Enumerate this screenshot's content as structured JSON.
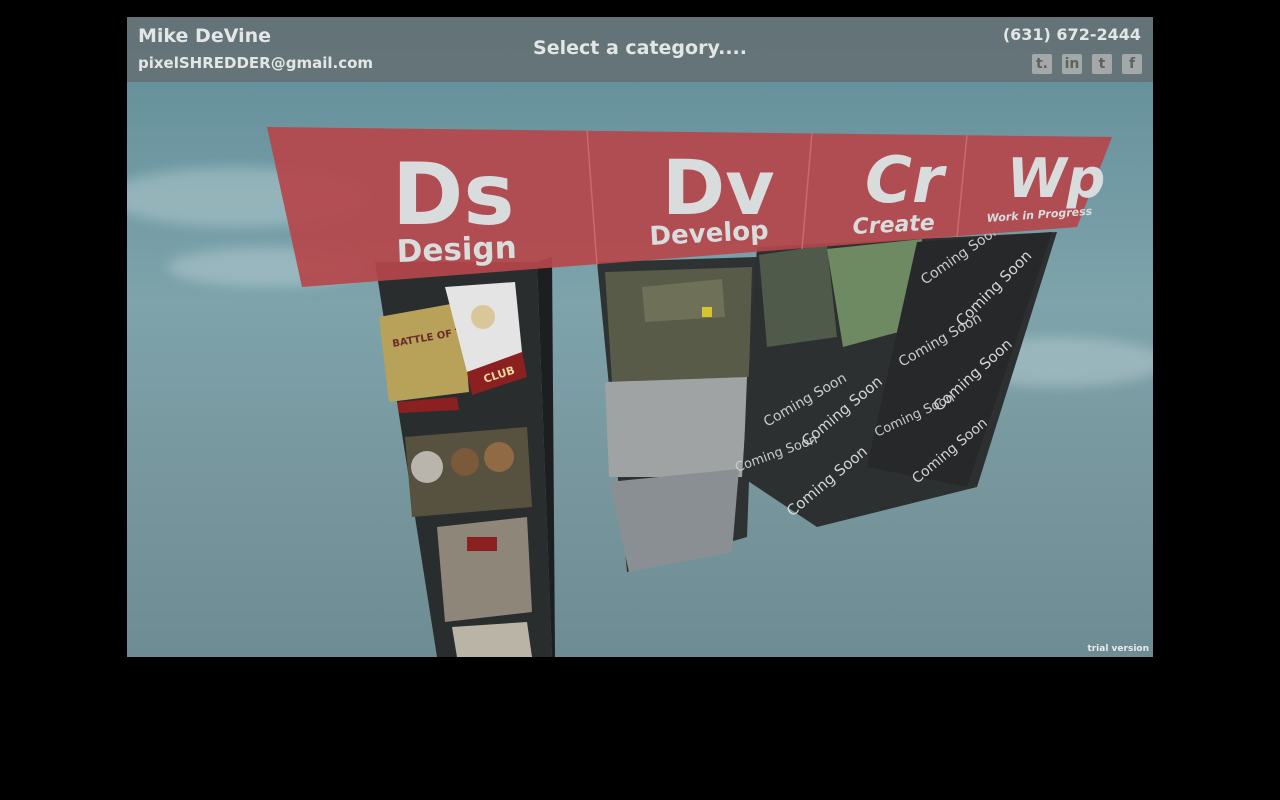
{
  "header": {
    "name": "Mike DeVine",
    "email": "pixelSHREDDER@gmail.com",
    "prompt": "Select a category....",
    "phone": "(631) 672-2444",
    "socials": [
      {
        "label": "t.",
        "icon": "tumblr-icon"
      },
      {
        "label": "in",
        "icon": "linkedin-icon"
      },
      {
        "label": "t",
        "icon": "twitter-icon"
      },
      {
        "label": "f",
        "icon": "facebook-icon"
      }
    ]
  },
  "categories": [
    {
      "abbr": "Ds",
      "label": "Design"
    },
    {
      "abbr": "Dv",
      "label": "Develop"
    },
    {
      "abbr": "Cr",
      "label": "Create"
    },
    {
      "abbr": "Wp",
      "label": "Work in Progress"
    }
  ],
  "design_items": [
    "BATTLE OF THE BANDS",
    "CLUB",
    "CLUB"
  ],
  "coming_soon": "Coming Soon",
  "watermark": "trial version",
  "colors": {
    "banner_red": "#b5474b",
    "overlay": "#646e70",
    "text": "#e3e6e6"
  }
}
